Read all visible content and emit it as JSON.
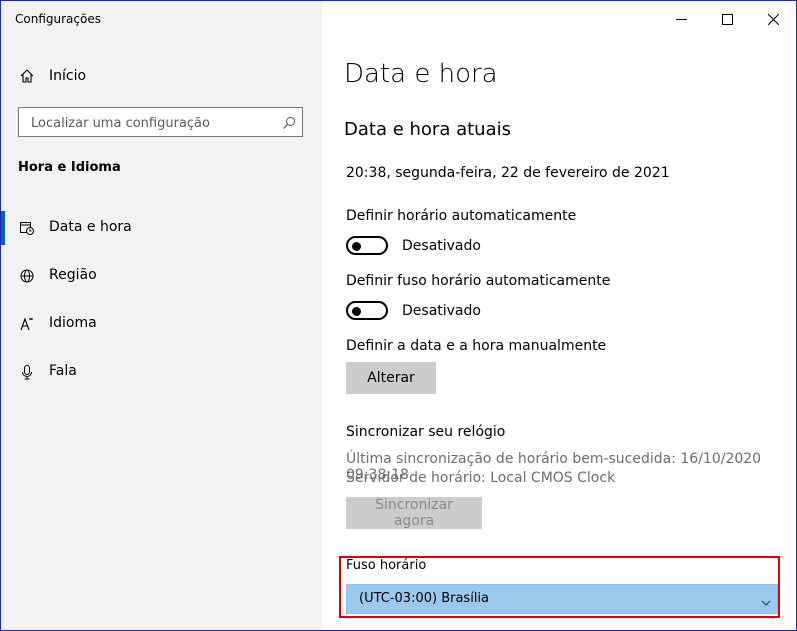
{
  "window": {
    "title": "Configurações"
  },
  "sidebar": {
    "home_label": "Início",
    "search_placeholder": "Localizar uma configuração",
    "section_heading": "Hora e Idioma",
    "items": [
      {
        "label": "Data e hora",
        "icon": "clock-calendar-icon",
        "active": true
      },
      {
        "label": "Região",
        "icon": "globe-icon",
        "active": false
      },
      {
        "label": "Idioma",
        "icon": "language-icon",
        "active": false
      },
      {
        "label": "Fala",
        "icon": "microphone-icon",
        "active": false
      }
    ]
  },
  "main": {
    "title": "Data e hora",
    "subheading": "Data e hora atuais",
    "current_datetime": "20:38, segunda-feira, 22 de fevereiro de 2021",
    "auto_time": {
      "label": "Definir horário automaticamente",
      "state": "Desativado",
      "on": false
    },
    "auto_timezone": {
      "label": "Definir fuso horário automaticamente",
      "state": "Desativado",
      "on": false
    },
    "manual": {
      "label": "Definir a data e a hora manualmente",
      "button": "Alterar"
    },
    "sync": {
      "heading": "Sincronizar seu relógio",
      "last_sync": "Última sincronização de horário bem-sucedida: 16/10/2020 09:38:18",
      "server": "Servidor de horário: Local CMOS Clock",
      "button": "Sincronizar agora"
    },
    "timezone": {
      "label": "Fuso horário",
      "value": "(UTC-03:00) Brasília"
    }
  },
  "colors": {
    "accent": "#0063b1",
    "sidebar_bg": "#f2f2f2",
    "highlight_border": "#e00000",
    "select_bg": "#99c9ef"
  }
}
